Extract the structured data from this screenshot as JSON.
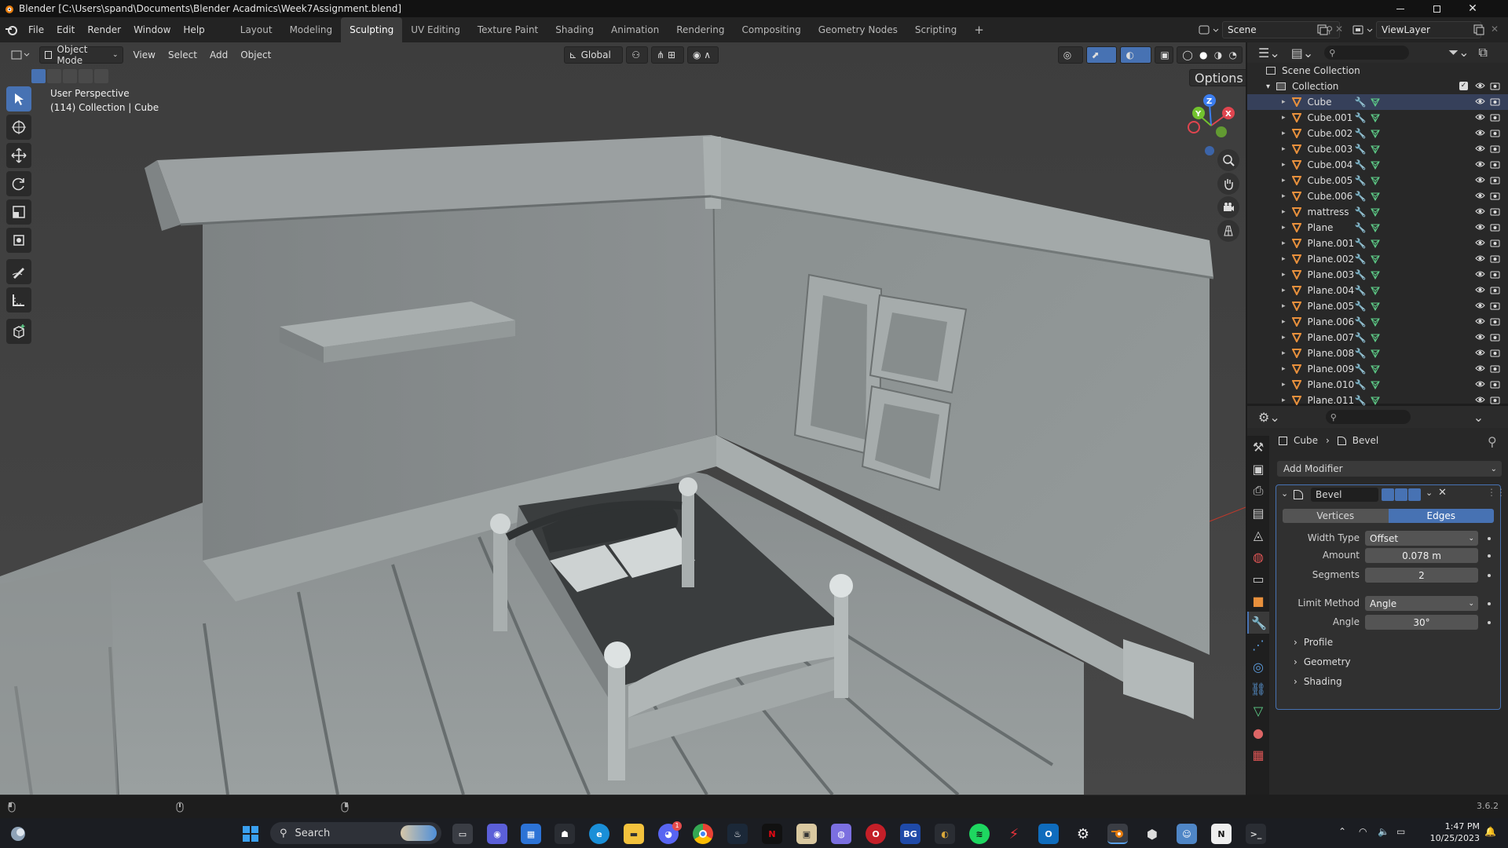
{
  "window": {
    "title": "Blender [C:\\Users\\spand\\Documents\\Blender Acadmics\\Week7Assignment.blend]"
  },
  "menu": {
    "items": [
      "File",
      "Edit",
      "Render",
      "Window",
      "Help"
    ]
  },
  "workspaces": {
    "tabs": [
      "Layout",
      "Modeling",
      "Sculpting",
      "UV Editing",
      "Texture Paint",
      "Shading",
      "Animation",
      "Rendering",
      "Compositing",
      "Geometry Nodes",
      "Scripting"
    ],
    "active": "Sculpting"
  },
  "scene": {
    "name": "Scene",
    "view_layer": "ViewLayer"
  },
  "viewport": {
    "mode": "Object Mode",
    "menus": [
      "View",
      "Select",
      "Add",
      "Object"
    ],
    "orientation": "Global",
    "options_label": "Options",
    "info_line1": "User Perspective",
    "info_line2": "(114) Collection | Cube",
    "gizmo_x": "X",
    "gizmo_y": "Y",
    "gizmo_z": "Z"
  },
  "outliner": {
    "scene_collection": "Scene Collection",
    "collection": "Collection",
    "objects": [
      "Cube",
      "Cube.001",
      "Cube.002",
      "Cube.003",
      "Cube.004",
      "Cube.005",
      "Cube.006",
      "mattress",
      "Plane",
      "Plane.001",
      "Plane.002",
      "Plane.003",
      "Plane.004",
      "Plane.005",
      "Plane.006",
      "Plane.007",
      "Plane.008",
      "Plane.009",
      "Plane.010",
      "Plane.011"
    ]
  },
  "properties": {
    "breadcrumb_object": "Cube",
    "breadcrumb_modifier": "Bevel",
    "add_modifier": "Add Modifier",
    "modifier_name": "Bevel",
    "tab_vertices": "Vertices",
    "tab_edges": "Edges",
    "active_tab": "Edges",
    "width_type_label": "Width Type",
    "width_type": "Offset",
    "amount_label": "Amount",
    "amount": "0.078 m",
    "segments_label": "Segments",
    "segments": "2",
    "limit_method_label": "Limit Method",
    "limit_method": "Angle",
    "angle_label": "Angle",
    "angle": "30°",
    "profile": "Profile",
    "geometry": "Geometry",
    "shading": "Shading"
  },
  "status": {
    "version": "3.6.2"
  },
  "taskbar": {
    "search": "Search",
    "time": "1:47 PM",
    "date": "10/25/2023",
    "discord_badge": "1"
  },
  "colors": {
    "accent": "#4772b3",
    "object_orange": "#e8903c",
    "mesh_green": "#5fd08a",
    "modifier_blue": "#5c9bdc"
  }
}
